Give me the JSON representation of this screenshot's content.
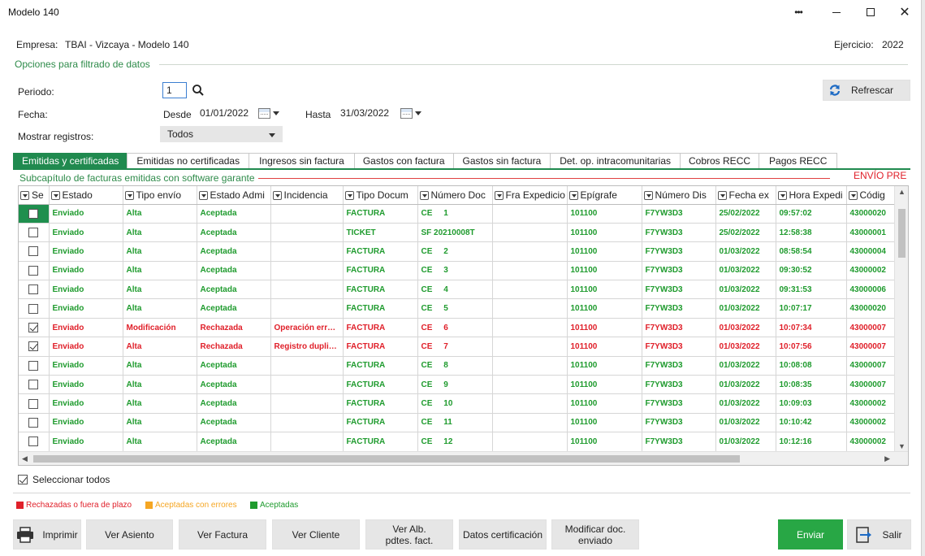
{
  "window": {
    "title": "Modelo 140"
  },
  "header": {
    "empresa_label": "Empresa:",
    "empresa_value": "TBAI - Vizcaya - Modelo 140",
    "ejercicio_label": "Ejercicio:",
    "ejercicio_value": "2022"
  },
  "filters": {
    "section_title": "Opciones para filtrado de datos",
    "periodo_label": "Periodo:",
    "periodo_value": "1",
    "fecha_label": "Fecha:",
    "desde_label": "Desde",
    "desde_value": "01/01/2022",
    "hasta_label": "Hasta",
    "hasta_value": "31/03/2022",
    "mostrar_label": "Mostrar registros:",
    "mostrar_value": "Todos",
    "refrescar_label": "Refrescar"
  },
  "tabs": [
    {
      "label": "Emitidas y certificadas"
    },
    {
      "label": "Emitidas no certificadas"
    },
    {
      "label": "Ingresos sin factura"
    },
    {
      "label": "Gastos con factura"
    },
    {
      "label": "Gastos sin factura"
    },
    {
      "label": "Det. op. intracomunitarias"
    },
    {
      "label": "Cobros RECC"
    },
    {
      "label": "Pagos RECC"
    }
  ],
  "subchapter": {
    "title": "Subcapítulo de facturas emitidas con software garante",
    "envio_badge": "ENVÍO PRE"
  },
  "grid": {
    "columns": [
      "Se",
      "Estado",
      "Tipo envío",
      "Estado Admi",
      "Incidencia",
      "Tipo Docum",
      "Número Doc",
      "Fra Expedicio",
      "Epígrafe",
      "Número Dis",
      "Fecha ex",
      "Hora Expedi",
      "Códig"
    ],
    "rows": [
      {
        "checked": false,
        "status": "ok",
        "estado": "Enviado",
        "tipo": "Alta",
        "admin": "Aceptada",
        "incidencia": "",
        "doc": "FACTURA",
        "num": "CE     1",
        "fra": "",
        "epigrafe": "101100",
        "disp": "F7YW3D3",
        "fecha": "25/02/2022",
        "hora": "09:57:02",
        "codigo": "43000020"
      },
      {
        "checked": false,
        "status": "ok",
        "estado": "Enviado",
        "tipo": "Alta",
        "admin": "Aceptada",
        "incidencia": "",
        "doc": "TICKET",
        "num": "SF 20210008T",
        "fra": "",
        "epigrafe": "101100",
        "disp": "F7YW3D3",
        "fecha": "25/02/2022",
        "hora": "12:58:38",
        "codigo": "43000001"
      },
      {
        "checked": false,
        "status": "ok",
        "estado": "Enviado",
        "tipo": "Alta",
        "admin": "Aceptada",
        "incidencia": "",
        "doc": "FACTURA",
        "num": "CE     2",
        "fra": "",
        "epigrafe": "101100",
        "disp": "F7YW3D3",
        "fecha": "01/03/2022",
        "hora": "08:58:54",
        "codigo": "43000004"
      },
      {
        "checked": false,
        "status": "ok",
        "estado": "Enviado",
        "tipo": "Alta",
        "admin": "Aceptada",
        "incidencia": "",
        "doc": "FACTURA",
        "num": "CE     3",
        "fra": "",
        "epigrafe": "101100",
        "disp": "F7YW3D3",
        "fecha": "01/03/2022",
        "hora": "09:30:52",
        "codigo": "43000002"
      },
      {
        "checked": false,
        "status": "ok",
        "estado": "Enviado",
        "tipo": "Alta",
        "admin": "Aceptada",
        "incidencia": "",
        "doc": "FACTURA",
        "num": "CE     4",
        "fra": "",
        "epigrafe": "101100",
        "disp": "F7YW3D3",
        "fecha": "01/03/2022",
        "hora": "09:31:53",
        "codigo": "43000006"
      },
      {
        "checked": false,
        "status": "ok",
        "estado": "Enviado",
        "tipo": "Alta",
        "admin": "Aceptada",
        "incidencia": "",
        "doc": "FACTURA",
        "num": "CE     5",
        "fra": "",
        "epigrafe": "101100",
        "disp": "F7YW3D3",
        "fecha": "01/03/2022",
        "hora": "10:07:17",
        "codigo": "43000020"
      },
      {
        "checked": true,
        "status": "err",
        "estado": "Enviado",
        "tipo": "Modificación",
        "admin": "Rechazada",
        "incidencia": "Operación erró...",
        "doc": "FACTURA",
        "num": "CE     6",
        "fra": "",
        "epigrafe": "101100",
        "disp": "F7YW3D3",
        "fecha": "01/03/2022",
        "hora": "10:07:34",
        "codigo": "43000007"
      },
      {
        "checked": true,
        "status": "err",
        "estado": "Enviado",
        "tipo": "Alta",
        "admin": "Rechazada",
        "incidencia": "Registro duplic...",
        "doc": "FACTURA",
        "num": "CE     7",
        "fra": "",
        "epigrafe": "101100",
        "disp": "F7YW3D3",
        "fecha": "01/03/2022",
        "hora": "10:07:56",
        "codigo": "43000007"
      },
      {
        "checked": false,
        "status": "ok",
        "estado": "Enviado",
        "tipo": "Alta",
        "admin": "Aceptada",
        "incidencia": "",
        "doc": "FACTURA",
        "num": "CE     8",
        "fra": "",
        "epigrafe": "101100",
        "disp": "F7YW3D3",
        "fecha": "01/03/2022",
        "hora": "10:08:08",
        "codigo": "43000007"
      },
      {
        "checked": false,
        "status": "ok",
        "estado": "Enviado",
        "tipo": "Alta",
        "admin": "Aceptada",
        "incidencia": "",
        "doc": "FACTURA",
        "num": "CE     9",
        "fra": "",
        "epigrafe": "101100",
        "disp": "F7YW3D3",
        "fecha": "01/03/2022",
        "hora": "10:08:35",
        "codigo": "43000007"
      },
      {
        "checked": false,
        "status": "ok",
        "estado": "Enviado",
        "tipo": "Alta",
        "admin": "Aceptada",
        "incidencia": "",
        "doc": "FACTURA",
        "num": "CE     10",
        "fra": "",
        "epigrafe": "101100",
        "disp": "F7YW3D3",
        "fecha": "01/03/2022",
        "hora": "10:09:03",
        "codigo": "43000002"
      },
      {
        "checked": false,
        "status": "ok",
        "estado": "Enviado",
        "tipo": "Alta",
        "admin": "Aceptada",
        "incidencia": "",
        "doc": "FACTURA",
        "num": "CE     11",
        "fra": "",
        "epigrafe": "101100",
        "disp": "F7YW3D3",
        "fecha": "01/03/2022",
        "hora": "10:10:42",
        "codigo": "43000002"
      },
      {
        "checked": false,
        "status": "ok",
        "estado": "Enviado",
        "tipo": "Alta",
        "admin": "Aceptada",
        "incidencia": "",
        "doc": "FACTURA",
        "num": "CE     12",
        "fra": "",
        "epigrafe": "101100",
        "disp": "F7YW3D3",
        "fecha": "01/03/2022",
        "hora": "10:12:16",
        "codigo": "43000002"
      }
    ]
  },
  "select_all_label": "Seleccionar todos",
  "legend": [
    {
      "label": "Rechazadas o fuera de plazo",
      "color": "#e0202a"
    },
    {
      "label": "Aceptadas con errores",
      "color": "#f5a623"
    },
    {
      "label": "Aceptadas",
      "color": "#1f9b2e"
    }
  ],
  "footer_buttons": {
    "imprimir": "Imprimir",
    "ver_asiento": "Ver Asiento",
    "ver_factura": "Ver Factura",
    "ver_cliente": "Ver Cliente",
    "ver_alb": "Ver Alb. pdtes. fact.",
    "datos_cert": "Datos certificación",
    "modificar_doc": "Modificar doc. enviado",
    "enviar": "Enviar",
    "salir": "Salir"
  }
}
